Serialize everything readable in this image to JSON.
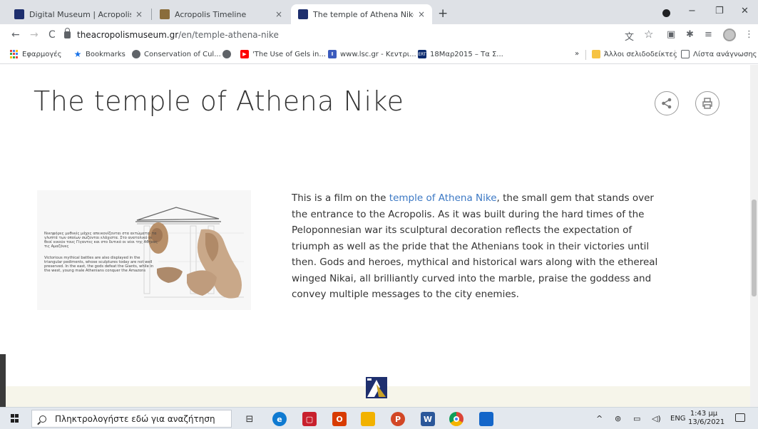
{
  "browser": {
    "tabs": [
      {
        "title": "Digital Museum | Acropolis Muse",
        "active": false
      },
      {
        "title": "Acropolis Timeline",
        "active": false
      },
      {
        "title": "The temple of Athena Nike | Acro",
        "active": true
      }
    ],
    "close_glyph": "×",
    "new_tab_glyph": "+",
    "url_host": "theacropolismuseum.gr",
    "url_path": "/en/temple-athena-nike",
    "nav": {
      "back": "←",
      "forward": "→",
      "reload": "C"
    },
    "window_controls": {
      "minimize": "−",
      "maximize": "❐",
      "close": "✕"
    },
    "toolbar_icons": {
      "translate": "⽂",
      "star": "☆",
      "ext": "▣",
      "puzzle": "✱",
      "queue": "≡",
      "menu": "⋮"
    }
  },
  "bookmarks": [
    {
      "label": "Εφαρμογές",
      "icon": "apps-grid-icon"
    },
    {
      "label": "Bookmarks",
      "icon": "star-icon"
    },
    {
      "label": "Conservation of Cul...",
      "icon": "globe-icon"
    },
    {
      "label": "",
      "icon": "globe-icon"
    },
    {
      "label": "'The Use of Gels in...",
      "icon": "youtube-icon"
    },
    {
      "label": "www.lsc.gr - Κεντρι...",
      "icon": "lsc-icon"
    },
    {
      "label": "18Μαρ2015 – Τα Σ...",
      "icon": "ert-icon"
    }
  ],
  "bookmarks_more": "»",
  "bookmarks_right": [
    {
      "label": "Άλλοι σελιδοδείκτες",
      "icon": "folder-icon"
    },
    {
      "label": "Λίστα ανάγνωσης",
      "icon": "reading-list-icon"
    }
  ],
  "page": {
    "title": "The temple of Athena Nike",
    "share_glyph": "⤴",
    "print_glyph": "⎙",
    "thumb_caption_1": "Νικηφόρες μυθικές μάχες απεικονίζονται στα αετώματα· τα γλυπτά των οποίων σώζονται ελάχιστα. Στο ανατολικό οι θεοί νικούν τους Γίγαντες και στο δυτικό οι νέοι της Αθήνας τις Αμαζόνες",
    "thumb_caption_2": "Victorious mythical battles are also displayed in the triangular pediments, whose sculptures today are not well preserved. In the east, the gods defeat the Giants, while in the west, young male Athenians conquer the Amazons",
    "desc_before": "This is a film on the ",
    "desc_link": "temple of Athena Nike",
    "desc_after": ", the small gem that stands over the entrance to the Acropolis. As it was built during the hard times of the Peloponnesian war its sculptural decoration reflects the expectation of triumph as well as the pride that the Athenians took in their victories until then. Gods and heroes, mythical and historical wars along with the ethereal winged Nikai, all brilliantly curved into the marble, praise the goddess and convey multiple messages to the city enemies."
  },
  "taskbar": {
    "search_placeholder": "Πληκτρολογήστε εδώ για αναζήτηση",
    "tray_lang": "ENG",
    "tray_chevron": "^",
    "time": "1:43 μμ",
    "date": "13/6/2021"
  },
  "colors": {
    "link": "#3b78c4",
    "footer_band": "#f6f5ea",
    "logo_blue": "#1e2f6e",
    "logo_gold": "#c9a227"
  }
}
